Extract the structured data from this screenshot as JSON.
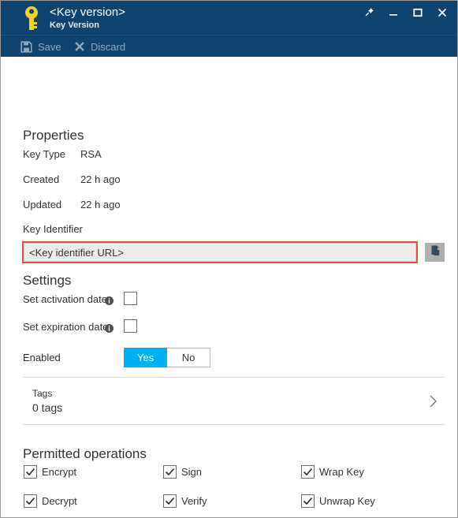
{
  "window": {
    "title": "<Key version>",
    "subtitle": "Key Version",
    "icon": "key-icon",
    "controls": [
      {
        "name": "pin-icon",
        "label": ""
      },
      {
        "name": "minimize-icon",
        "label": ""
      },
      {
        "name": "maximize-icon",
        "label": ""
      },
      {
        "name": "close-icon",
        "label": ""
      }
    ]
  },
  "commandbar": {
    "save_label": "Save",
    "discard_label": "Discard",
    "save_icon": "save-icon",
    "discard_icon": "discard-icon"
  },
  "properties": {
    "heading": "Properties",
    "rows": [
      {
        "label": "Key Type",
        "value": "RSA"
      },
      {
        "label": "Created",
        "value": "22 h ago"
      },
      {
        "label": "Updated",
        "value": "22 h ago"
      }
    ],
    "key_identifier_label": "Key Identifier",
    "key_identifier_value": "<Key identifier URL>",
    "copy_icon": "copy-icon"
  },
  "settings": {
    "heading": "Settings",
    "activation_label": "Set activation date.",
    "activation_checked": false,
    "expiration_label": "Set expiration date.",
    "expiration_checked": false,
    "enabled_label": "Enabled",
    "enabled_yes": "Yes",
    "enabled_no": "No",
    "enabled_selected": "Yes",
    "info_icon": "info-icon"
  },
  "tags": {
    "label": "Tags",
    "value": "0 tags",
    "chevron_icon": "chevron-right-icon"
  },
  "permitted_operations": {
    "heading": "Permitted operations",
    "items": [
      {
        "label": "Encrypt",
        "checked": true
      },
      {
        "label": "Sign",
        "checked": true
      },
      {
        "label": "Wrap Key",
        "checked": true
      },
      {
        "label": "Decrypt",
        "checked": true
      },
      {
        "label": "Verify",
        "checked": true
      },
      {
        "label": "Unwrap Key",
        "checked": true
      }
    ]
  },
  "colors": {
    "header_bg": "#0f4471",
    "accent": "#00b0f0",
    "key_yellow": "#f5d020",
    "highlight_border": "#e8503a"
  }
}
